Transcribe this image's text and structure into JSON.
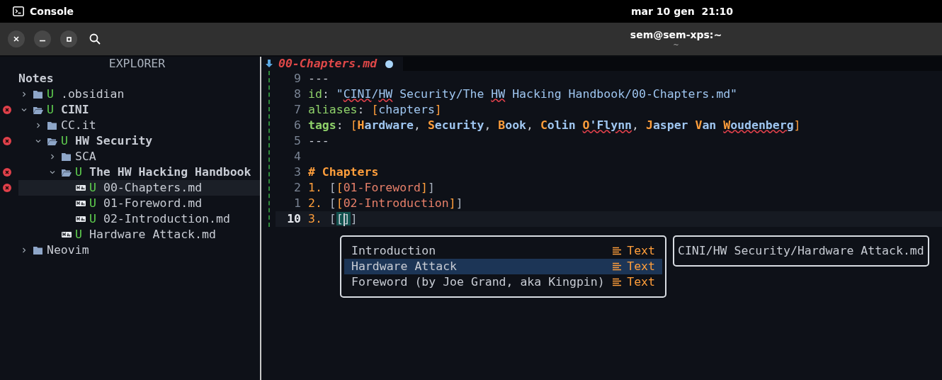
{
  "topbar": {
    "app": "Console",
    "clock": "mar 10 gen  21:10"
  },
  "window": {
    "title": "sem@sem-xps:~",
    "subtitle": "~"
  },
  "explorer": {
    "title": "EXPLORER",
    "root": "Notes",
    "items": [
      {
        "name": ".obsidian",
        "kind": "folder",
        "expanded": false,
        "git": "U",
        "error": false,
        "bold": false,
        "selected": false
      },
      {
        "name": "CINI",
        "kind": "folder",
        "expanded": true,
        "git": "U",
        "error": true,
        "bold": true,
        "selected": false,
        "children": [
          {
            "name": "CC.it",
            "kind": "folder",
            "expanded": false,
            "error": false,
            "bold": false,
            "selected": false
          },
          {
            "name": "HW Security",
            "kind": "folder",
            "expanded": true,
            "git": "U",
            "error": true,
            "bold": true,
            "selected": false,
            "children": [
              {
                "name": "SCA",
                "kind": "folder",
                "expanded": false,
                "error": false,
                "bold": false,
                "selected": false
              },
              {
                "name": "The HW Hacking Handbook",
                "kind": "folder",
                "expanded": true,
                "git": "U",
                "error": true,
                "bold": true,
                "selected": false,
                "children": [
                  {
                    "name": "00-Chapters.md",
                    "kind": "file",
                    "git": "U",
                    "error": true,
                    "bold": false,
                    "selected": true
                  },
                  {
                    "name": "01-Foreword.md",
                    "kind": "file",
                    "git": "U",
                    "error": false,
                    "bold": false,
                    "selected": false
                  },
                  {
                    "name": "02-Introduction.md",
                    "kind": "file",
                    "git": "U",
                    "error": false,
                    "bold": false,
                    "selected": false
                  }
                ]
              },
              {
                "name": "Hardware Attack.md",
                "kind": "file",
                "git": "U",
                "error": false,
                "bold": false,
                "selected": false
              }
            ]
          }
        ]
      },
      {
        "name": "Neovim",
        "kind": "folder",
        "expanded": false,
        "error": false,
        "bold": false,
        "selected": false
      }
    ]
  },
  "editor": {
    "tab": {
      "name": "00-Chapters.md",
      "modified": true
    },
    "lines": [
      {
        "number": "9",
        "current": false,
        "segments": [
          {
            "text": "---",
            "kind": "plain"
          }
        ]
      },
      {
        "number": "8",
        "current": false,
        "segments": [
          {
            "text": "id",
            "kind": "key"
          },
          {
            "text": ": ",
            "kind": "plain"
          },
          {
            "text": "\"",
            "kind": "string"
          },
          {
            "text": "CINI",
            "kind": "string",
            "misspelled": true
          },
          {
            "text": "/",
            "kind": "string"
          },
          {
            "text": "HW",
            "kind": "string",
            "misspelled": true
          },
          {
            "text": " Security/The ",
            "kind": "string"
          },
          {
            "text": "HW",
            "kind": "string",
            "misspelled": true
          },
          {
            "text": " Hacking Handbook/00-Chapters.md\"",
            "kind": "string"
          }
        ]
      },
      {
        "number": "7",
        "current": false,
        "segments": [
          {
            "text": "aliases",
            "kind": "key"
          },
          {
            "text": ": ",
            "kind": "plain"
          },
          {
            "text": "[",
            "kind": "bracket"
          },
          {
            "text": "chapters",
            "kind": "string"
          },
          {
            "text": "]",
            "kind": "bracket"
          }
        ]
      },
      {
        "number": "6",
        "current": false,
        "segments": [
          {
            "text": "tags",
            "kind": "key_bold"
          },
          {
            "text": ": ",
            "kind": "plain"
          },
          {
            "text": "[",
            "kind": "bracket"
          },
          {
            "text": "H",
            "kind": "tag_head"
          },
          {
            "text": "ardware",
            "kind": "tag"
          },
          {
            "text": ", ",
            "kind": "plain"
          },
          {
            "text": "S",
            "kind": "tag_head"
          },
          {
            "text": "ecurity",
            "kind": "tag"
          },
          {
            "text": ", ",
            "kind": "plain"
          },
          {
            "text": "B",
            "kind": "tag_head"
          },
          {
            "text": "ook",
            "kind": "tag"
          },
          {
            "text": ", ",
            "kind": "plain"
          },
          {
            "text": "C",
            "kind": "tag_head"
          },
          {
            "text": "olin ",
            "kind": "tag"
          },
          {
            "text": "O",
            "kind": "tag_head",
            "misspelled": true
          },
          {
            "text": "'Flynn",
            "kind": "tag",
            "misspelled": true
          },
          {
            "text": ", ",
            "kind": "plain"
          },
          {
            "text": "J",
            "kind": "tag_head"
          },
          {
            "text": "asper ",
            "kind": "tag"
          },
          {
            "text": "V",
            "kind": "tag_head"
          },
          {
            "text": "an ",
            "kind": "tag"
          },
          {
            "text": "W",
            "kind": "tag_head",
            "misspelled": true
          },
          {
            "text": "oudenberg",
            "kind": "tag",
            "misspelled": true
          },
          {
            "text": "]",
            "kind": "bracket"
          }
        ]
      },
      {
        "number": "5",
        "current": false,
        "segments": [
          {
            "text": "---",
            "kind": "plain"
          }
        ]
      },
      {
        "number": "4",
        "current": false
      },
      {
        "number": "3",
        "current": false,
        "segments": [
          {
            "text": "# Chapters",
            "kind": "heading"
          }
        ]
      },
      {
        "number": "2",
        "current": false,
        "segments": [
          {
            "text": "1. ",
            "kind": "list"
          },
          {
            "text": "[",
            "kind": "bracket_dim"
          },
          {
            "text": "[",
            "kind": "bracket"
          },
          {
            "text": "01-Foreword",
            "kind": "link"
          },
          {
            "text": "]",
            "kind": "bracket"
          },
          {
            "text": "]",
            "kind": "bracket_dim"
          }
        ]
      },
      {
        "number": "1",
        "current": false,
        "segments": [
          {
            "text": "2. ",
            "kind": "list"
          },
          {
            "text": "[",
            "kind": "bracket_dim"
          },
          {
            "text": "[",
            "kind": "bracket"
          },
          {
            "text": "02-Introduction",
            "kind": "link"
          },
          {
            "text": "]",
            "kind": "bracket"
          },
          {
            "text": "]",
            "kind": "bracket_dim"
          }
        ]
      },
      {
        "number": "10",
        "current": true,
        "segments": [
          {
            "text": "3. ",
            "kind": "list"
          },
          {
            "text": "[",
            "kind": "bracket_dim"
          },
          {
            "text": "[",
            "kind": "match"
          },
          {
            "text": "]",
            "kind": "match",
            "cursor_before": true
          },
          {
            "text": "]",
            "kind": "bracket_dim"
          }
        ]
      }
    ]
  },
  "completion": {
    "items": [
      {
        "label": "Introduction",
        "type": "Text",
        "selected": false
      },
      {
        "label": "Hardware Attack",
        "type": "Text",
        "selected": true
      },
      {
        "label": "Foreword (by Joe Grand, aka Kingpin)",
        "type": "Text",
        "selected": false
      }
    ],
    "preview": "CINI/HW Security/Hardware Attack.md"
  }
}
